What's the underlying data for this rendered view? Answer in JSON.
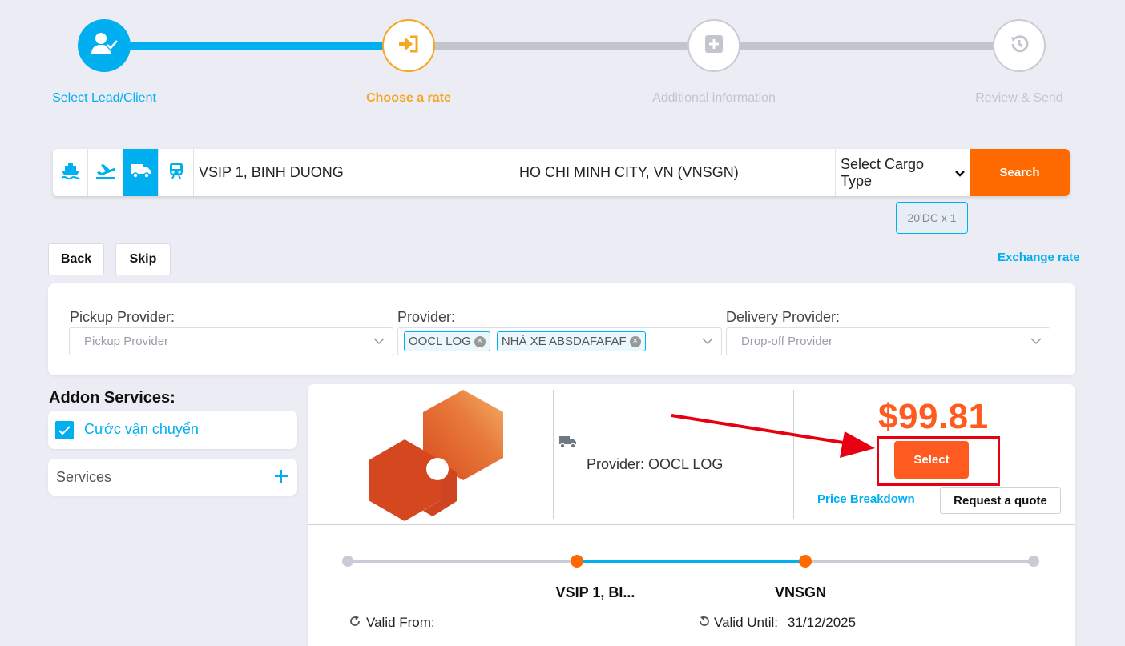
{
  "stepper": {
    "steps": [
      {
        "label": "Select Lead/Client",
        "state": "done"
      },
      {
        "label": "Choose a rate",
        "state": "current"
      },
      {
        "label": "Additional information",
        "state": "pending"
      },
      {
        "label": "Review & Send",
        "state": "pending"
      }
    ]
  },
  "search": {
    "modes": [
      "ship-icon",
      "plane-icon",
      "truck-icon",
      "train-icon"
    ],
    "active_mode": "truck-icon",
    "origin": "VSIP 1, BINH DUONG",
    "destination": "HO CHI MINH CITY, VN (VNSGN)",
    "cargo_type": "Select Cargo Type",
    "search_label": "Search",
    "container_badge": "20'DC x 1"
  },
  "actions": {
    "back_label": "Back",
    "skip_label": "Skip",
    "exchange_rate_label": "Exchange rate"
  },
  "providers": {
    "pickup_label": "Pickup Provider:",
    "pickup_placeholder": "Pickup Provider",
    "provider_label": "Provider:",
    "provider_tags": [
      "OOCL LOG",
      "NHÀ XE ABSDAFAFAF"
    ],
    "delivery_label": "Delivery Provider:",
    "delivery_placeholder": "Drop-off Provider"
  },
  "addons": {
    "title": "Addon Services:",
    "checkbox_label": "Cước vận chuyển",
    "checked": true,
    "services_label": "Services"
  },
  "rate": {
    "provider_text": "Provider: OOCL LOG",
    "price": "$99.81",
    "select_label": "Select",
    "price_breakdown_label": "Price Breakdown",
    "request_quote_label": "Request a quote",
    "route_from": "VSIP 1, BI...",
    "route_to": "VNSGN",
    "valid_from_label": "Valid From:",
    "valid_until_label": "Valid Until:",
    "valid_until_value": "31/12/2025"
  },
  "colors": {
    "accent": "#00aff0",
    "orange": "#ff6a00",
    "price": "#ff5a1f",
    "annotation_red": "#e60012"
  }
}
